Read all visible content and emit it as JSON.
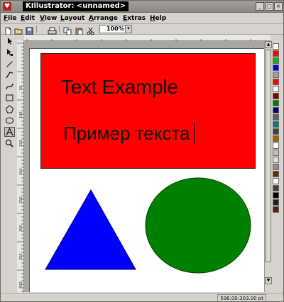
{
  "window": {
    "title": "KIllustrator: <unnamed>",
    "app_icon": "♥"
  },
  "menubar": {
    "items": [
      {
        "accel": "F",
        "rest": "ile"
      },
      {
        "accel": "E",
        "rest": "dit"
      },
      {
        "accel": "V",
        "rest": "iew"
      },
      {
        "accel": "L",
        "rest": "ayout"
      },
      {
        "accel": "A",
        "rest": "rrange"
      },
      {
        "accel": "E",
        "rest": "xtras"
      },
      {
        "accel": "H",
        "rest": "elp"
      }
    ]
  },
  "toolbar": {
    "icons": [
      "new-file-icon",
      "open-file-icon",
      "save-file-icon",
      "print-icon",
      "copy-icon",
      "paste-icon",
      "cut-icon"
    ],
    "zoom": "100%"
  },
  "tools": {
    "icons": [
      "pointer-icon",
      "node-edit-icon",
      "freehand-icon",
      "polyline-icon",
      "bezier-icon",
      "rectangle-icon",
      "polygon-icon",
      "ellipse-icon",
      "text-icon",
      "zoom-icon"
    ],
    "selected": "text-icon"
  },
  "vruler": {
    "labels": [
      "50",
      "100",
      "150",
      "200",
      "250",
      "300",
      "350",
      "400",
      "450"
    ]
  },
  "document": {
    "text_en": "Text Example",
    "text_ru": "Пример текста",
    "colors": {
      "rectangle": "#ff0000",
      "triangle": "#0000ff",
      "ellipse": "#008000"
    }
  },
  "palette": {
    "colors": [
      "#ffffff",
      "#ff0000",
      "#00c000",
      "#0000ff",
      "#a0a0a0",
      "#ff0000",
      "#ffffff",
      "#800000",
      "#008000",
      "#000080",
      "#606060",
      "#008080",
      "#404040",
      "#a06000",
      "#ffffff",
      "#c0c0c0",
      "#e0e0e0",
      "#909090",
      "#603000",
      "#ffffff",
      "#404040",
      "#000000",
      "#202020",
      "#602000"
    ]
  },
  "status": {
    "coords": "596.00:303.00 pt"
  }
}
